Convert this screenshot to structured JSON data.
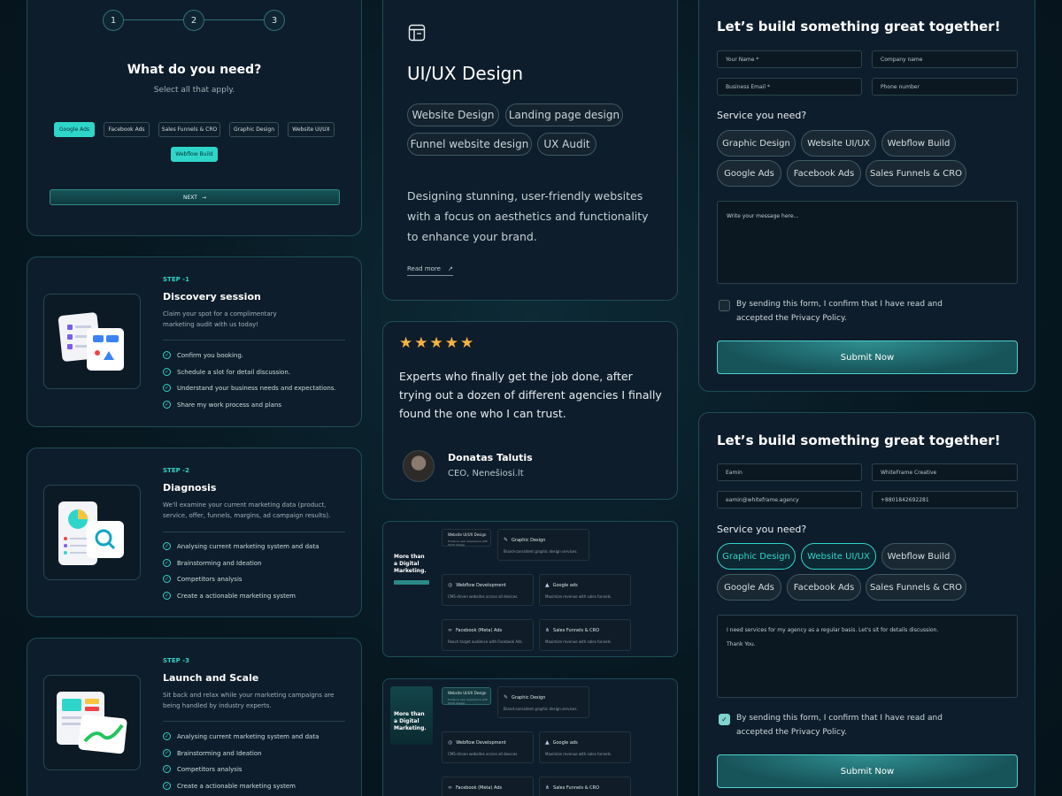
{
  "wizard": {
    "steps": [
      "1",
      "2",
      "3"
    ],
    "title": "What do you need?",
    "subtitle": "Select all that apply.",
    "options": [
      {
        "label": "Google Ads",
        "selected": true
      },
      {
        "label": "Facebook Ads",
        "selected": false
      },
      {
        "label": "Sales Funnels & CRO",
        "selected": false
      },
      {
        "label": "Graphic Design",
        "selected": false
      },
      {
        "label": "Website UI/UX",
        "selected": false
      },
      {
        "label": "Webflow Build",
        "selected": true
      }
    ],
    "next_label": "NEXT"
  },
  "process_steps": [
    {
      "label": "STEP -1",
      "title": "Discovery session",
      "desc": "Claim your spot for a complimentary marketing audit with us today!",
      "checks": [
        "Confirm you booking.",
        "Schedule a slot for detail discussion.",
        "Understand your business needs and expectations.",
        "Share my work process and plans"
      ]
    },
    {
      "label": "STEP -2",
      "title": "Diagnosis",
      "desc": "We'll examine your current marketing data (product, service, offer, funnels, margins, ad campaign results).",
      "checks": [
        "Analysing current marketing system and data",
        "Brainstorming and Ideation",
        "Competitors analysis",
        "Create a actionable marketing system"
      ]
    },
    {
      "label": "STEP -3",
      "title": "Launch and Scale",
      "desc": "Sit back and relax while your marketing campaigns are being handled by industry experts.",
      "checks": [
        "Analysing current marketing system and data",
        "Brainstorming and Ideation",
        "Competitors analysis",
        "Create a actionable marketing system"
      ]
    }
  ],
  "service_card": {
    "title": "UI/UX Design",
    "tags": [
      "Website Design",
      "Landing page design",
      "Funnel website design",
      "UX Audit"
    ],
    "description": "Designing stunning, user-friendly websites with a focus on aesthetics and functionality to enhance your brand.",
    "read_more": "Read more"
  },
  "testimonial": {
    "rating": 5,
    "quote": "Experts who finally get the job done, after trying out a dozen of different agencies I finally found the one who I can trust.",
    "name": "Donatas Talutis",
    "role": "CEO, Nenešiosi.lt"
  },
  "services_grid": {
    "sidebar_title": "More than a Digital Marketing.",
    "cards": [
      {
        "title": "Website UI/UX Design",
        "desc": "Enhance user experience with UI/UX design."
      },
      {
        "title": "Graphic Design",
        "desc": "Brand-consistent graphic design services."
      },
      {
        "title": "Webflow Development",
        "desc": "CMS-driven websites across all devices."
      },
      {
        "title": "Google ads",
        "desc": "Maximize revenue with sales funnels."
      },
      {
        "title": "Facebook (Meta) Ads",
        "desc": "Reach target audience with Facebook Ads."
      },
      {
        "title": "Sales Funnels & CRO",
        "desc": "Maximize revenue with sales funnels."
      }
    ]
  },
  "form_empty": {
    "title": "Let’s build something great together!",
    "fields": {
      "name": "Your Name *",
      "company": "Company name",
      "email": "Business Email *",
      "phone": "Phone number"
    },
    "service_label": "Service you need?",
    "services": [
      {
        "label": "Graphic Design",
        "selected": false
      },
      {
        "label": "Website UI/UX",
        "selected": false
      },
      {
        "label": "Webflow Build",
        "selected": false
      },
      {
        "label": "Google Ads",
        "selected": false
      },
      {
        "label": "Facebook Ads",
        "selected": false
      },
      {
        "label": "Sales Funnels & CRO",
        "selected": false
      }
    ],
    "message_placeholder": "Write your message here...",
    "consent": "By sending this form, I confirm that I have read and accepted the Privacy Policy.",
    "consent_checked": false,
    "submit": "Submit Now"
  },
  "form_filled": {
    "title": "Let’s build something great together!",
    "fields": {
      "name": "Eamin",
      "company": "WhiteFrame Creative",
      "email": "eamin@whiteframe.agency",
      "phone": "+8801842692281"
    },
    "service_label": "Service you need?",
    "services": [
      {
        "label": "Graphic Design",
        "selected": true
      },
      {
        "label": "Website UI/UX",
        "selected": true
      },
      {
        "label": "Webflow Build",
        "selected": false
      },
      {
        "label": "Google Ads",
        "selected": false
      },
      {
        "label": "Facebook Ads",
        "selected": false
      },
      {
        "label": "Sales Funnels & CRO",
        "selected": false
      }
    ],
    "message_line1": "I need services for my agency as a regular basis. Let's sit for details discussion.",
    "message_line2": "Thank You.",
    "consent": "By sending this form, I confirm that I have read and accepted the Privacy Policy.",
    "consent_checked": true,
    "submit": "Submit Now"
  },
  "colors": {
    "accent": "#2ed6c9",
    "card_bg": "#0e1d2b",
    "border": "#1d4e55",
    "page_bg": "#071821"
  }
}
